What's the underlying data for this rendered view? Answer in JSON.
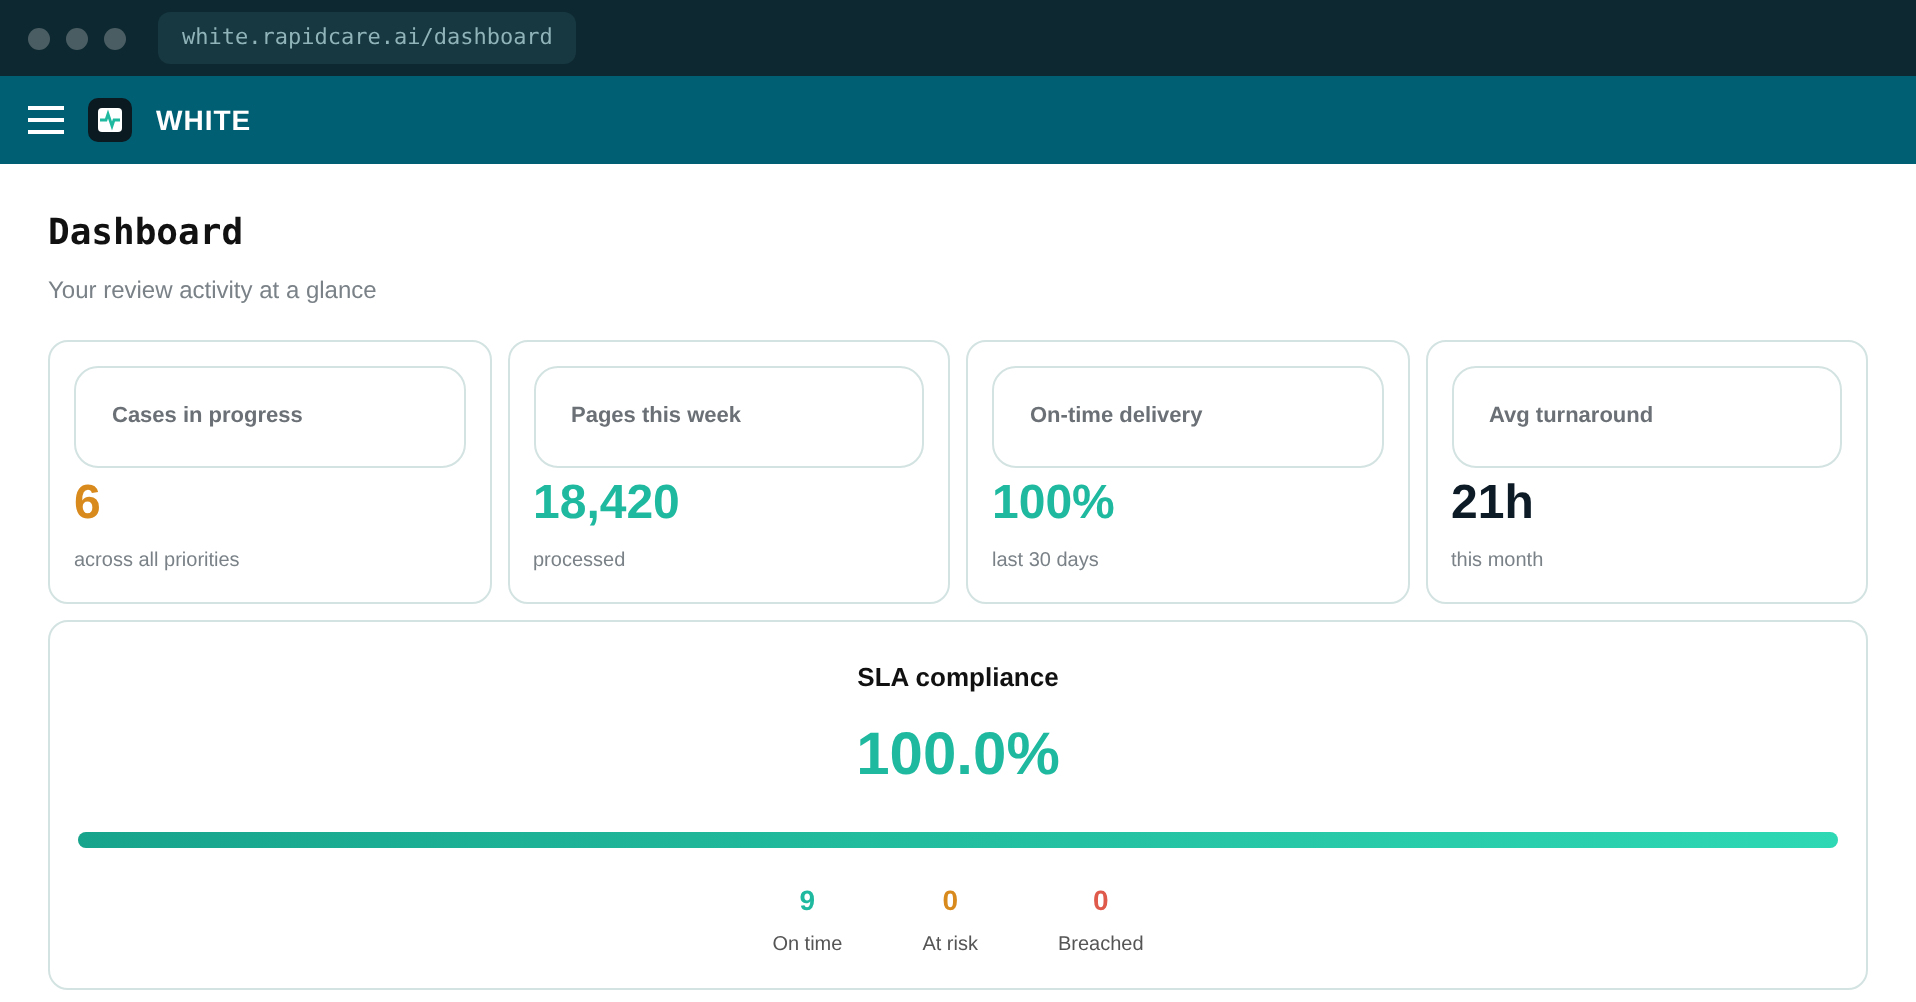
{
  "browser": {
    "url": "white.rapidcare.ai/dashboard"
  },
  "navbar": {
    "brand": "WHITE"
  },
  "page": {
    "title": "Dashboard",
    "subtitle": "Your review activity at a glance"
  },
  "stats": [
    {
      "label": "Cases in progress",
      "value": "6",
      "note": "across all priorities",
      "color": "#d98a1c"
    },
    {
      "label": "Pages this week",
      "value": "18,420",
      "note": "processed",
      "color": "#1fb9a0"
    },
    {
      "label": "On-time delivery",
      "value": "100%",
      "note": "last 30 days",
      "color": "#1fb9a0"
    },
    {
      "label": "Avg turnaround",
      "value": "21h",
      "note": "this month",
      "color": "#0d1b26"
    }
  ],
  "sla": {
    "title": "SLA compliance",
    "value": "100.0%",
    "level": 1.0,
    "counts": [
      {
        "value": "9",
        "label": "On time",
        "color": "#1fb9a0"
      },
      {
        "value": "0",
        "label": "At risk",
        "color": "#d98a1c"
      },
      {
        "value": "0",
        "label": "Breached",
        "color": "#e05a4b"
      }
    ]
  }
}
